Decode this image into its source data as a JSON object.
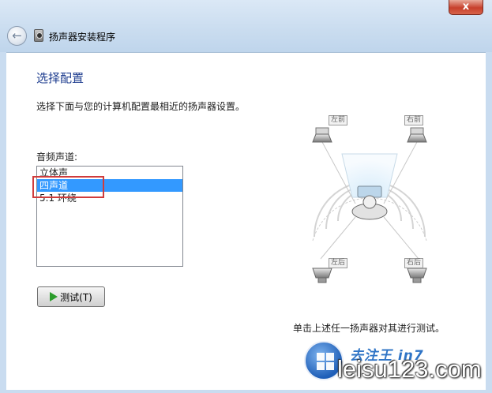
{
  "window": {
    "close_label": "x"
  },
  "wizard": {
    "title": "扬声器安装程序"
  },
  "page": {
    "heading": "选择配置",
    "description": "选择下面与您的计算机配置最相近的扬声器设置。",
    "list_label": "音频声道:",
    "channels": [
      {
        "label": "立体声",
        "selected": false
      },
      {
        "label": "四声道",
        "selected": true
      },
      {
        "label": "5.1 环绕",
        "selected": false
      }
    ],
    "test_button": "测试(T)",
    "hint": "单击上述任一扬声器对其进行测试。"
  },
  "diagram": {
    "front_left": "左前",
    "front_right": "右前",
    "rear_left": "左后",
    "rear_right": "右后"
  },
  "watermark": {
    "line1": "去注王 in7",
    "line2": "leisu123.com"
  },
  "colors": {
    "selection": "#3399ff",
    "heading": "#1e3d8f",
    "highlight": "#d03c3c"
  }
}
